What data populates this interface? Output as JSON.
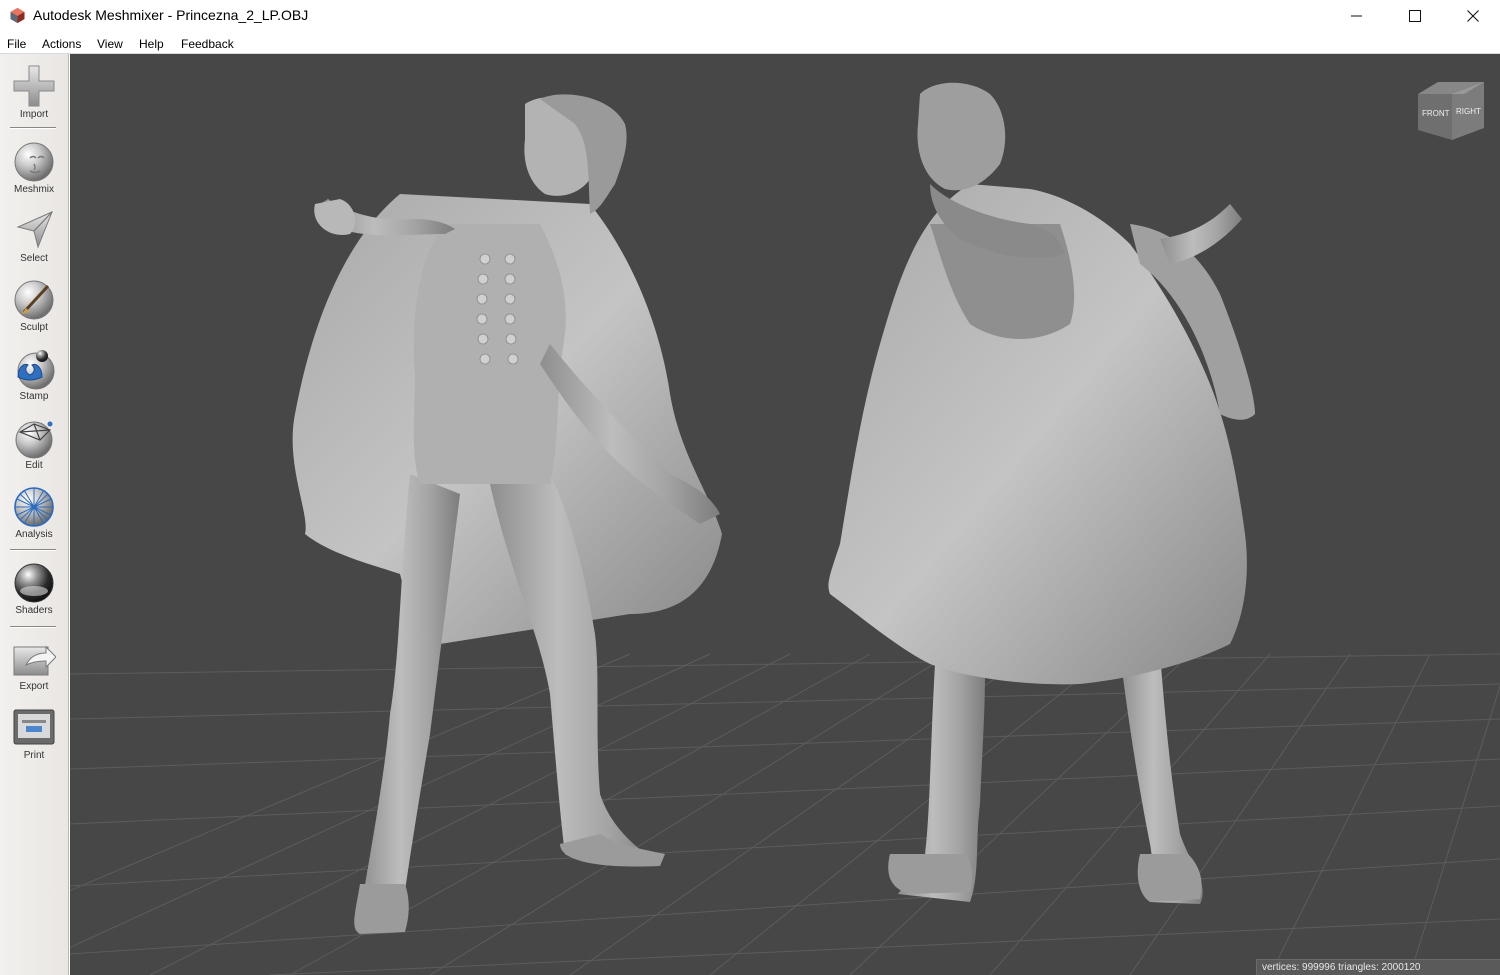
{
  "window": {
    "title": "Autodesk Meshmixer - Princezna_2_LP.OBJ",
    "icon": "meshmixer-app-icon",
    "controls": [
      "minimize-icon",
      "maximize-icon",
      "close-icon"
    ]
  },
  "menu": {
    "file": "File",
    "actions": "Actions",
    "view": "View",
    "help": "Help",
    "feedback": "Feedback"
  },
  "toolbar": {
    "items": [
      {
        "label": "Import",
        "icon": "plus-icon"
      },
      {
        "label": "Meshmix",
        "icon": "meshmix-head-icon"
      },
      {
        "label": "Select",
        "icon": "cursor-arrow-icon"
      },
      {
        "label": "Sculpt",
        "icon": "brush-sphere-icon"
      },
      {
        "label": "Stamp",
        "icon": "stamp-icon"
      },
      {
        "label": "Edit",
        "icon": "edit-sphere-icon"
      },
      {
        "label": "Analysis",
        "icon": "analysis-sphere-icon"
      },
      {
        "label": "Shaders",
        "icon": "shader-sphere-icon"
      },
      {
        "label": "Export",
        "icon": "export-icon"
      },
      {
        "label": "Print",
        "icon": "printer-icon"
      }
    ]
  },
  "viewcube": {
    "front": "FRONT",
    "right": "RIGHT"
  },
  "status": {
    "text": "vertices: 999996 triangles: 2000120"
  },
  "colors": {
    "viewport_bg": "#474747",
    "grid": "#5c5c5c",
    "model": "#a9a9a9",
    "toolbar_bg": "#ece9e6"
  }
}
